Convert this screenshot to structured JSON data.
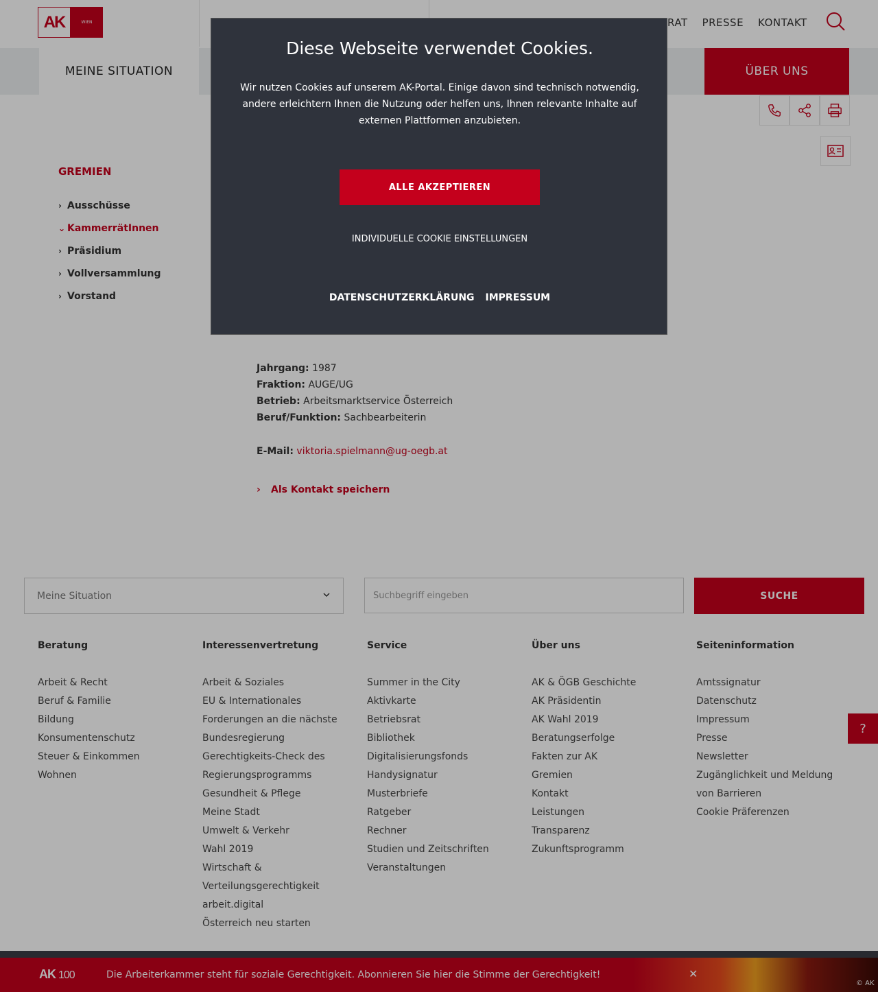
{
  "header": {
    "logo_text": "AK",
    "logo_region": "WIEN",
    "nav": [
      "RAT",
      "PRESSE",
      "KONTAKT"
    ]
  },
  "navbar": {
    "meine_situation": "MEINE SITUATION",
    "ueber_uns": "ÜBER UNS"
  },
  "sidebar": {
    "title": "GREMIEN",
    "items": [
      {
        "label": "Ausschüsse",
        "active": false
      },
      {
        "label": "KammerrätInnen",
        "active": true
      },
      {
        "label": "Präsidium",
        "active": false
      },
      {
        "label": "Vollversammlung",
        "active": false
      },
      {
        "label": "Vorstand",
        "active": false
      }
    ]
  },
  "profile": {
    "jahrgang_label": "Jahrgang:",
    "jahrgang": "1987",
    "fraktion_label": "Fraktion:",
    "fraktion": "AUGE/UG",
    "betrieb_label": "Betrieb:",
    "betrieb": "Arbeitsmarktservice Österreich",
    "beruf_label": "Beruf/Funktion:",
    "beruf": "Sachbearbeiterin",
    "email_label": "E-Mail:",
    "email": "viktoria.spielmann@ug-oegb.at",
    "save_contact": "Als Kontakt speichern"
  },
  "footer_search": {
    "select_value": "Meine Situation",
    "search_placeholder": "Suchbegriff eingeben",
    "search_button": "SUCHE"
  },
  "footer_columns": [
    {
      "title": "Beratung",
      "links": [
        "Arbeit & Recht",
        "Beruf & Familie",
        "Bildung",
        "Konsumentenschutz",
        "Steuer & Einkommen",
        "Wohnen"
      ]
    },
    {
      "title": "Interessenvertretung",
      "links": [
        "Arbeit & Soziales",
        "EU & Internationales",
        "Forderungen an die nächste",
        "Bundesregierung",
        "Gerechtigkeits-Check des",
        "Regierungsprogramms",
        "Gesundheit & Pflege",
        "Meine Stadt",
        "Umwelt & Verkehr",
        "Wahl 2019",
        "Wirtschaft &",
        "Verteilungsgerechtigkeit",
        "arbeit.digital",
        "Österreich neu starten"
      ]
    },
    {
      "title": "Service",
      "links": [
        "Summer in the City",
        "Aktivkarte",
        "Betriebsrat",
        "Bibliothek",
        "Digitalisierungsfonds",
        "Handysignatur",
        "Musterbriefe",
        "Ratgeber",
        "Rechner",
        "Studien und Zeitschriften",
        "Veranstaltungen"
      ]
    },
    {
      "title": "Über uns",
      "links": [
        "AK & ÖGB Geschichte",
        "AK Präsidentin",
        "AK Wahl 2019",
        "Beratungserfolge",
        "Fakten zur AK",
        "Gremien",
        "Kontakt",
        "Leistungen",
        "Transparenz",
        "Zukunftsprogramm"
      ]
    },
    {
      "title": "Seiteninformation",
      "links": [
        "Amtssignatur",
        "Datenschutz",
        "Impressum",
        "Presse",
        "Newsletter",
        "Zugänglichkeit und Meldung",
        "von Barrieren",
        "Cookie Präferenzen"
      ]
    }
  ],
  "help_button": "?",
  "banner": {
    "logo": "AK",
    "logo_suffix": "100",
    "text": "Die Arbeiterkammer steht für soziale Gerechtigkeit. Abonnieren Sie hier die Stimme der Gerechtigkeit!",
    "close": "✕",
    "copyright": "© AK"
  },
  "cookie_modal": {
    "title": "Diese Webseite verwendet Cookies.",
    "text": "Wir nutzen Cookies auf unserem AK-Portal. Einige davon sind technisch notwendig, andere erleichtern Ihnen die Nutzung oder helfen uns, Ihnen relevante Inhalte auf externen Plattformen anzubieten.",
    "accept": "ALLE AKZEPTIEREN",
    "individual": "INDIVIDUELLE COOKIE EINSTELLUNGEN",
    "privacy": "DATENSCHUTZERKLÄRUNG",
    "imprint": "IMPRESSUM"
  },
  "colors": {
    "accent": "#c4001c",
    "modal_bg": "#2f333c"
  }
}
